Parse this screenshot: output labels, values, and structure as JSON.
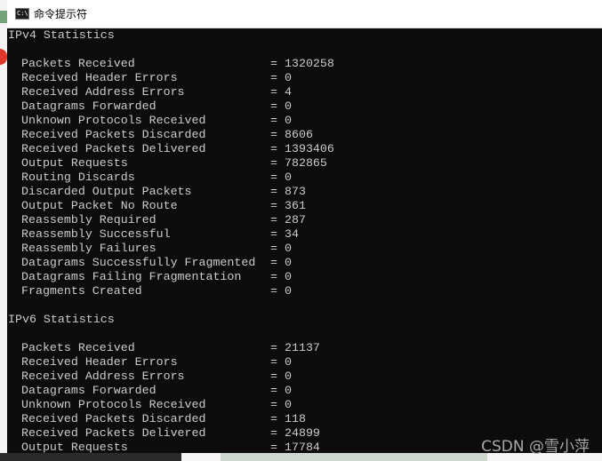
{
  "window": {
    "title": "命令提示符",
    "icon_glyph": "C:\\"
  },
  "ipv4": {
    "heading": "IPv4 Statistics",
    "rows": [
      {
        "name": "Packets Received",
        "value": "1320258"
      },
      {
        "name": "Received Header Errors",
        "value": "0"
      },
      {
        "name": "Received Address Errors",
        "value": "4"
      },
      {
        "name": "Datagrams Forwarded",
        "value": "0"
      },
      {
        "name": "Unknown Protocols Received",
        "value": "0"
      },
      {
        "name": "Received Packets Discarded",
        "value": "8606"
      },
      {
        "name": "Received Packets Delivered",
        "value": "1393406"
      },
      {
        "name": "Output Requests",
        "value": "782865"
      },
      {
        "name": "Routing Discards",
        "value": "0"
      },
      {
        "name": "Discarded Output Packets",
        "value": "873"
      },
      {
        "name": "Output Packet No Route",
        "value": "361"
      },
      {
        "name": "Reassembly Required",
        "value": "287"
      },
      {
        "name": "Reassembly Successful",
        "value": "34"
      },
      {
        "name": "Reassembly Failures",
        "value": "0"
      },
      {
        "name": "Datagrams Successfully Fragmented",
        "value": "0"
      },
      {
        "name": "Datagrams Failing Fragmentation",
        "value": "0"
      },
      {
        "name": "Fragments Created",
        "value": "0"
      }
    ]
  },
  "ipv6": {
    "heading": "IPv6 Statistics",
    "rows": [
      {
        "name": "Packets Received",
        "value": "21137"
      },
      {
        "name": "Received Header Errors",
        "value": "0"
      },
      {
        "name": "Received Address Errors",
        "value": "0"
      },
      {
        "name": "Datagrams Forwarded",
        "value": "0"
      },
      {
        "name": "Unknown Protocols Received",
        "value": "0"
      },
      {
        "name": "Received Packets Discarded",
        "value": "118"
      },
      {
        "name": "Received Packets Delivered",
        "value": "24899"
      },
      {
        "name": "Output Requests",
        "value": "17784"
      }
    ]
  },
  "equals_sign": "=",
  "watermark": "CSDN @雪小萍",
  "colors": {
    "console_bg": "#0c0c0c",
    "console_text": "#cccccc",
    "titlebar_bg": "#ffffff"
  }
}
